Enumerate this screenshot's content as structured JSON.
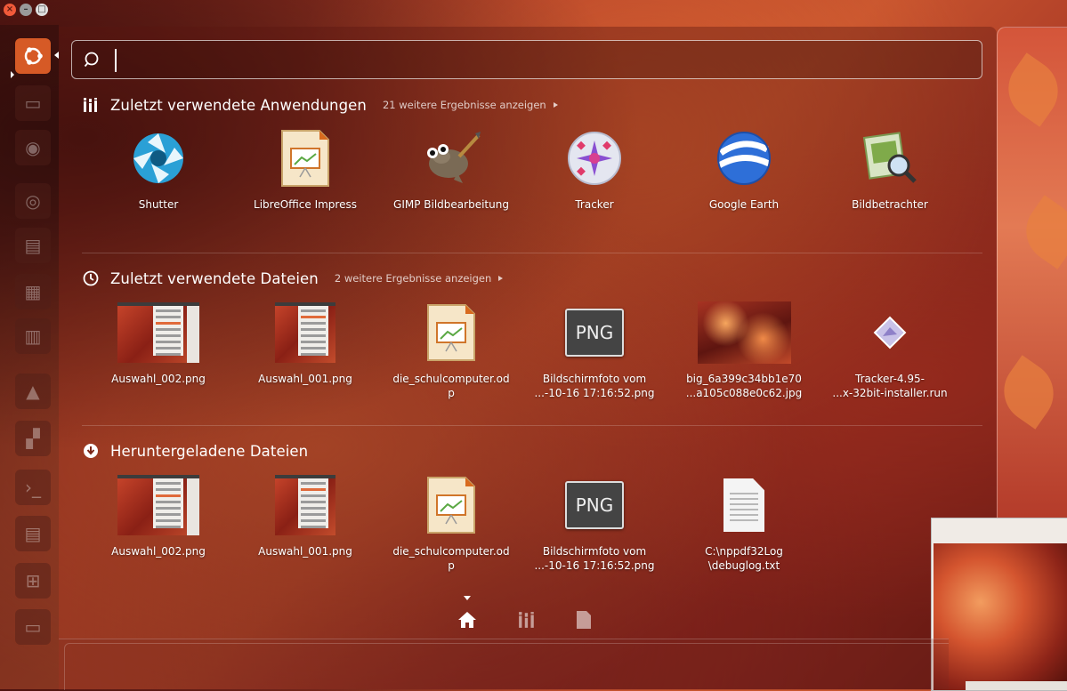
{
  "search": {
    "query": "",
    "placeholder": ""
  },
  "categories": {
    "apps": {
      "title": "Zuletzt verwendete Anwendungen",
      "more": "21 weitere Ergebnisse anzeigen",
      "items": [
        {
          "label": "Shutter",
          "icon": "shutter-icon"
        },
        {
          "label": "LibreOffice Impress",
          "icon": "libreoffice-impress-icon"
        },
        {
          "label": "GIMP Bildbearbeitung",
          "icon": "gimp-icon"
        },
        {
          "label": "Tracker",
          "icon": "tracker-icon"
        },
        {
          "label": "Google Earth",
          "icon": "google-earth-icon"
        },
        {
          "label": "Bildbetrachter",
          "icon": "image-viewer-icon"
        }
      ]
    },
    "recent_files": {
      "title": "Zuletzt verwendete  Dateien",
      "more": "2 weitere Ergebnisse anzeigen",
      "items": [
        {
          "label": "Auswahl_002.png"
        },
        {
          "label": "Auswahl_001.png"
        },
        {
          "label": "die_schulcomputer.od\np"
        },
        {
          "label": "Bildschirmfoto vom\n...-10-16 17:16:52.png",
          "badge": "PNG"
        },
        {
          "label": "big_6a399c34bb1e70\n...a105c088e0c62.jpg"
        },
        {
          "label": "Tracker-4.95-\n...x-32bit-installer.run"
        }
      ]
    },
    "downloads": {
      "title": "Heruntergeladene Dateien",
      "items": [
        {
          "label": "Auswahl_002.png"
        },
        {
          "label": "Auswahl_001.png"
        },
        {
          "label": "die_schulcomputer.od\np"
        },
        {
          "label": "Bildschirmfoto vom\n...-10-16 17:16:52.png",
          "badge": "PNG"
        },
        {
          "label": "C:\\nppdf32Log\n\\debuglog.txt"
        }
      ]
    }
  },
  "nav": [
    "home-icon",
    "applications-lens-icon",
    "files-lens-icon"
  ],
  "colors": {
    "accent": "#d65a26"
  }
}
